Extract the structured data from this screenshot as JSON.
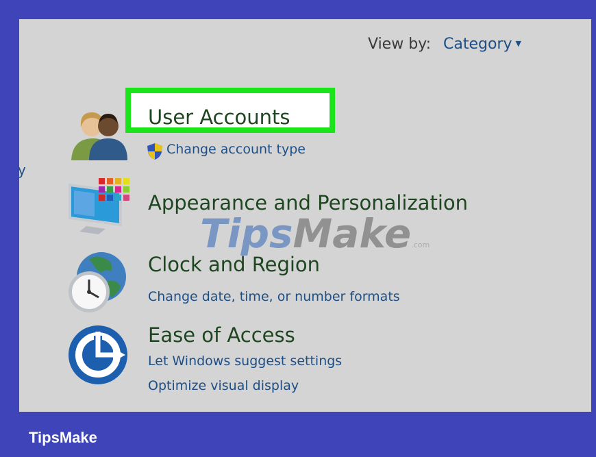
{
  "header": {
    "view_by_label": "View by:",
    "view_by_value": "Category"
  },
  "edge_fragment": "y",
  "categories": [
    {
      "title": "User Accounts",
      "links": [
        "Change account type"
      ],
      "icon": "users-icon"
    },
    {
      "title": "Appearance and Personalization",
      "links": [],
      "icon": "monitor-icon"
    },
    {
      "title": "Clock and Region",
      "links": [
        "Change date, time, or number formats"
      ],
      "icon": "clock-globe-icon"
    },
    {
      "title": "Ease of Access",
      "links": [
        "Let Windows suggest settings",
        "Optimize visual display"
      ],
      "icon": "ease-of-access-icon"
    }
  ],
  "watermark": {
    "part1": "Tips",
    "part2": "Make",
    "suffix": ".com"
  },
  "footer": {
    "brand": "TipsMake"
  },
  "colors": {
    "frame": "#3f45b8",
    "panel": "#d4d4d4",
    "highlight": "#1be41b",
    "link": "#1d4f86",
    "title": "#1e4620"
  }
}
